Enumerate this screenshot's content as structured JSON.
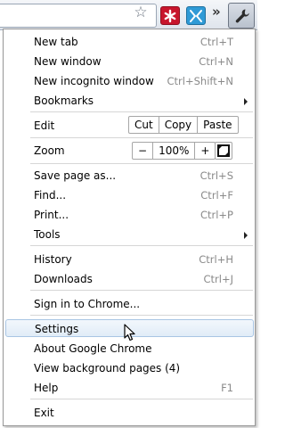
{
  "toolbar": {
    "star_icon": "bookmark-star-icon",
    "extensions": [
      "lastpass-extension-icon",
      "blue-extension-icon"
    ],
    "overflow_label": "»",
    "menu_icon": "wrench-icon"
  },
  "menu": {
    "new_tab": {
      "label": "New tab",
      "shortcut": "Ctrl+T"
    },
    "new_window": {
      "label": "New window",
      "shortcut": "Ctrl+N"
    },
    "new_incognito": {
      "label": "New incognito window",
      "shortcut": "Ctrl+Shift+N"
    },
    "bookmarks": {
      "label": "Bookmarks"
    },
    "edit": {
      "label": "Edit",
      "cut": "Cut",
      "copy": "Copy",
      "paste": "Paste"
    },
    "zoom": {
      "label": "Zoom",
      "minus": "−",
      "value": "100%",
      "plus": "+"
    },
    "save_page": {
      "label": "Save page as...",
      "shortcut": "Ctrl+S"
    },
    "find": {
      "label": "Find...",
      "shortcut": "Ctrl+F"
    },
    "print": {
      "label": "Print...",
      "shortcut": "Ctrl+P"
    },
    "tools": {
      "label": "Tools"
    },
    "history": {
      "label": "History",
      "shortcut": "Ctrl+H"
    },
    "downloads": {
      "label": "Downloads",
      "shortcut": "Ctrl+J"
    },
    "sign_in": {
      "label": "Sign in to Chrome..."
    },
    "settings": {
      "label": "Settings"
    },
    "about": {
      "label": "About Google Chrome"
    },
    "background_pages": {
      "label": "View background pages (4)"
    },
    "help": {
      "label": "Help",
      "shortcut": "F1"
    },
    "exit": {
      "label": "Exit"
    }
  },
  "colors": {
    "highlight_border": "#a9c5e3",
    "highlight_fill": "#e1ecf7",
    "shortcut_text": "#8a8a8a"
  }
}
